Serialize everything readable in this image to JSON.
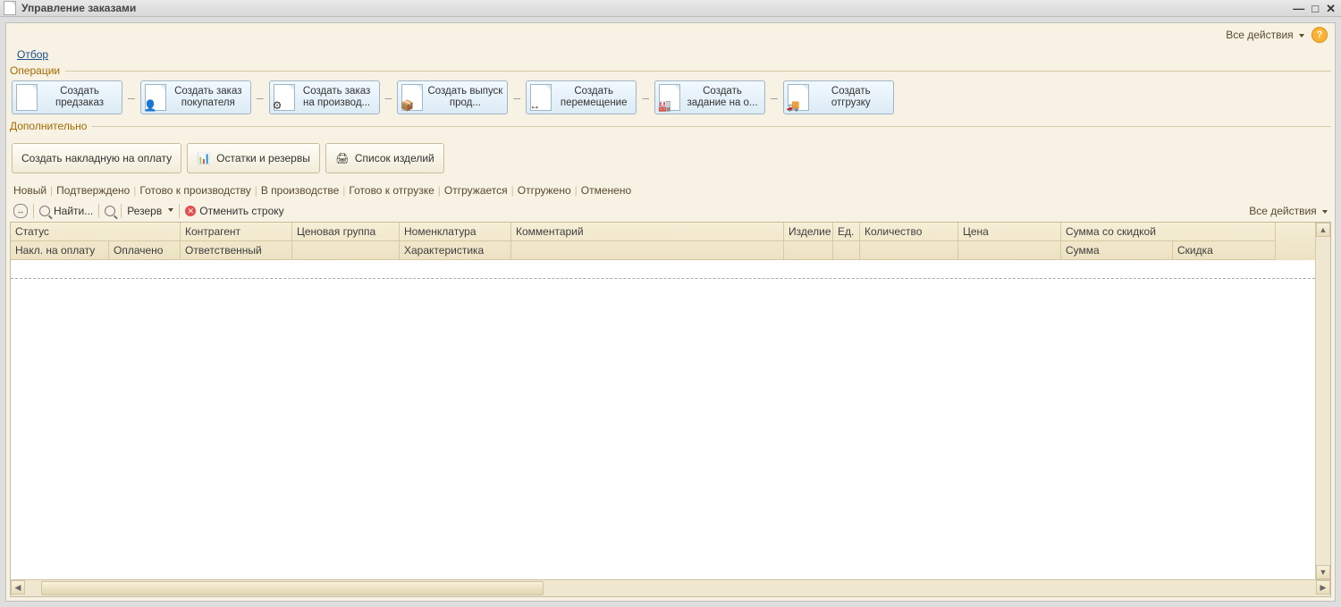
{
  "window": {
    "title": "Управление заказами"
  },
  "topbar": {
    "all_actions": "Все действия"
  },
  "filter": {
    "label": "Отбор"
  },
  "operations": {
    "title": "Операции",
    "btn_preorder": "Создать предзаказ",
    "btn_buyer_order": "Создать заказ покупателя",
    "btn_prod_order": "Создать заказ на производ...",
    "btn_release": "Создать выпуск прод...",
    "btn_move": "Создать перемещение",
    "btn_task": "Создать задание на о...",
    "btn_ship": "Создать отгрузку"
  },
  "additional": {
    "title": "Дополнительно",
    "btn_invoice": "Создать накладную на оплату",
    "btn_stock": "Остатки и резервы",
    "btn_products": "Список изделий"
  },
  "statuses": {
    "new": "Новый",
    "confirmed": "Подтверждено",
    "ready_prod": "Готово к производству",
    "in_prod": "В производстве",
    "ready_ship": "Готово к отгрузке",
    "shipping": "Отгружается",
    "shipped": "Отгружено",
    "cancelled": "Отменено"
  },
  "toolbar": {
    "find": "Найти...",
    "reserve": "Резерв",
    "cancel_row": "Отменить строку",
    "all_actions": "Все действия"
  },
  "columns": {
    "status": "Статус",
    "counterparty": "Контрагент",
    "price_group": "Ценовая группа",
    "nomenclature": "Номенклатура",
    "comment": "Комментарий",
    "product": "Изделие",
    "unit": "Ед.",
    "qty": "Количество",
    "price": "Цена",
    "sum_discount": "Сумма со скидкой",
    "invoice": "Накл. на оплату",
    "paid": "Оплачено",
    "responsible": "Ответственный",
    "characteristic": "Характеристика",
    "sum": "Сумма",
    "discount": "Скидка"
  }
}
